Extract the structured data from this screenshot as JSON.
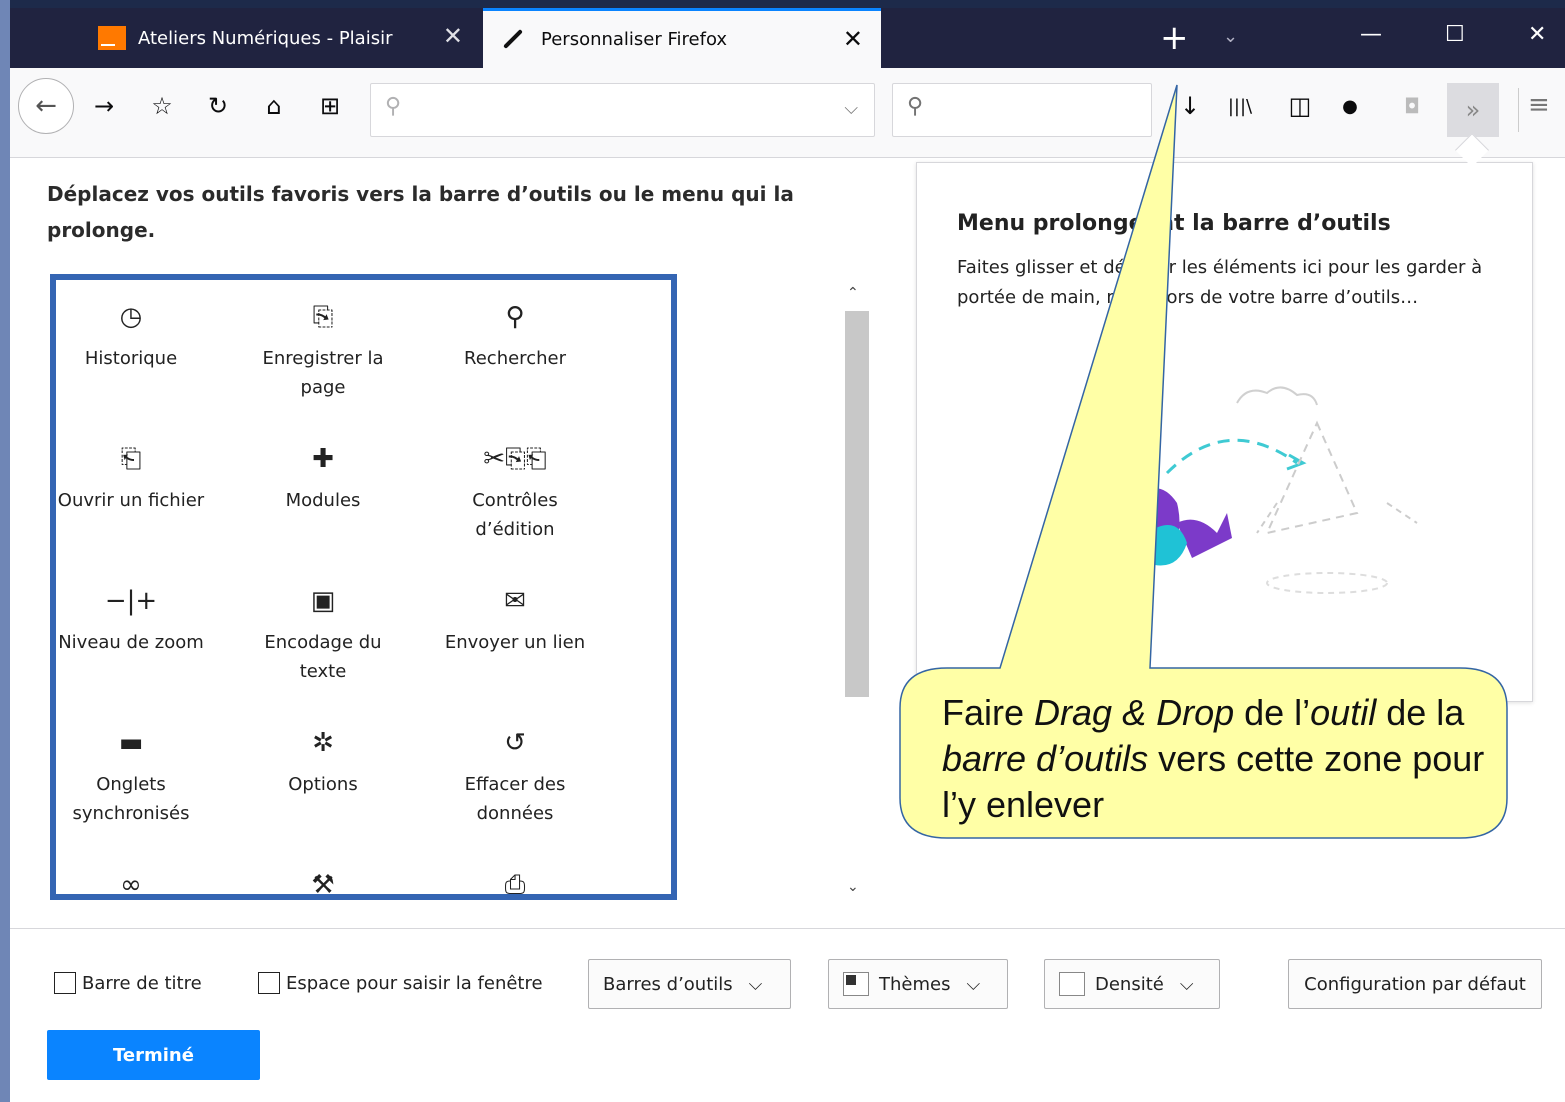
{
  "tabs": [
    {
      "title": "Ateliers Numériques - Plaisir",
      "close": "✕",
      "favicon": "orange-icon"
    },
    {
      "title": "Personnaliser Firefox",
      "close": "✕",
      "favicon": "paintbrush-icon"
    }
  ],
  "tabstrip": {
    "new_tab": "+",
    "list_tabs": "⌄"
  },
  "window_controls": {
    "minimize": "—",
    "maximize": "☐",
    "close": "✕"
  },
  "toolbar": {
    "back": "←",
    "forward": "→",
    "bookmark": "☆",
    "reload": "↻",
    "home": "⌂",
    "new_window": "⊞",
    "url_placeholder": "",
    "search_placeholder": "",
    "download": "↓",
    "library": "|||\\",
    "sidebar": "◫",
    "ext": "●",
    "pocket": "◘",
    "overflow": "»",
    "menu": "≡"
  },
  "content": {
    "instruction": "Déplacez vos outils favoris vers la barre d’outils ou le menu qui la prolonge."
  },
  "palette_items": [
    {
      "icon": "history-icon",
      "glyph": "◷",
      "label": "Historique"
    },
    {
      "icon": "save-page-icon",
      "glyph": "⎙",
      "label": "Enregistrer la page"
    },
    {
      "icon": "search-icon",
      "glyph": "🔍︎",
      "label": "Rechercher"
    },
    {
      "icon": "open-file-icon",
      "glyph": "⎗",
      "label": "Ouvrir un fichier"
    },
    {
      "icon": "addons-icon",
      "glyph": "✚",
      "label": "Modules"
    },
    {
      "icon": "edit-controls-icon",
      "glyph": "✂ ⎘ ⎗",
      "label": "Contrôles d’édition"
    },
    {
      "icon": "zoom-controls-icon",
      "glyph": "− | +",
      "label": "Niveau de zoom"
    },
    {
      "icon": "text-encoding-icon",
      "glyph": "▣",
      "label": "Encodage du texte"
    },
    {
      "icon": "email-link-icon",
      "glyph": "✉",
      "label": "Envoyer un lien"
    },
    {
      "icon": "synced-tabs-icon",
      "glyph": "▬",
      "label": "Onglets synchronisés"
    },
    {
      "icon": "options-gear-icon",
      "glyph": "✲",
      "label": "Options"
    },
    {
      "icon": "forget-icon",
      "glyph": "↺",
      "label": "Effacer des données"
    },
    {
      "icon": "private-mask-icon",
      "glyph": "∞",
      "label": ""
    },
    {
      "icon": "developer-wrench-icon",
      "glyph": "⚲",
      "label": ""
    },
    {
      "icon": "print-icon",
      "glyph": "⎙",
      "label": ""
    }
  ],
  "overflow_panel": {
    "title": "Menu prolongeant la barre d’outils",
    "description": "Faites glisser et déposer les éléments ici pour les garder à portée de main, mais hors de votre barre d’outils…"
  },
  "callout": {
    "text_1": "Faire ",
    "text_2": "Drag & Drop",
    "text_3": " de l’",
    "text_4": "outil",
    "text_5": " de la ",
    "text_6": "barre d’outils",
    "text_7": " vers cette zone pour l’y enlever",
    "fill": "#ffffa6",
    "stroke": "#3465a4"
  },
  "footer": {
    "title_bar_label": "Barre de titre",
    "drag_space_label": "Espace pour saisir la fenêtre",
    "toolbars_label": "Barres d’outils",
    "themes_label": "Thèmes",
    "density_label": "Densité",
    "restore_label": "Configuration par défaut",
    "done_label": "Terminé",
    "chevron": "⌵"
  },
  "colors": {
    "accent": "#0a84ff",
    "palette_border": "#3465b3",
    "tabstrip": "#202340"
  }
}
